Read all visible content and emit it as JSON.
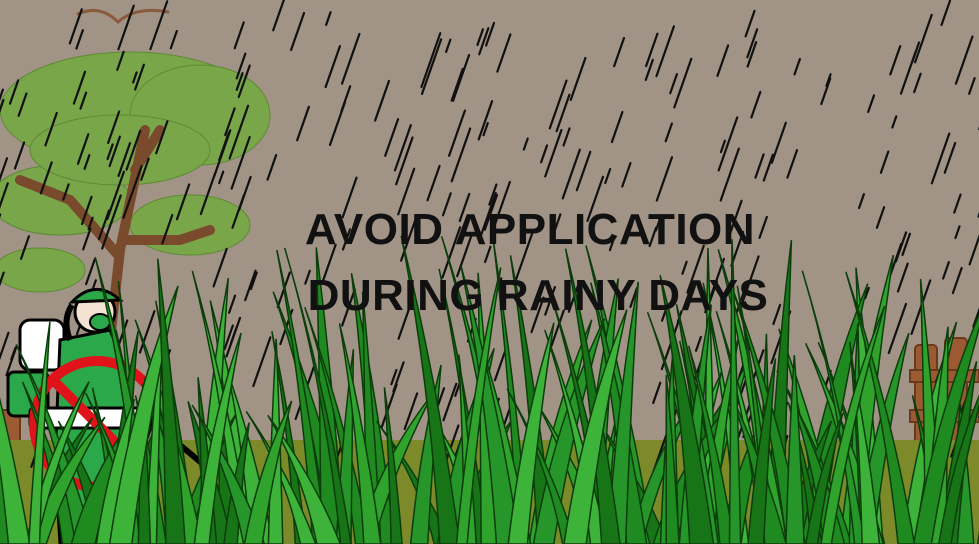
{
  "headline": {
    "line1": "AVOID APPLICATION",
    "line2": "DURING RAINY DAYS"
  },
  "colors": {
    "sky": "#a19386",
    "rain": "#111111",
    "tree_foliage": "#7aa64a",
    "tree_trunk": "#7a4a2c",
    "grass": "#1f8a1f",
    "grass_light": "#3db33a",
    "ground": "#7c8a2a",
    "worker_suit": "#2aa84a",
    "prohibition": "#e0121a",
    "fence": "#9b5a32"
  },
  "icons": [
    "rain-icon",
    "tree-icon",
    "bird-icon",
    "worker-icon",
    "prohibition-icon",
    "fence-icon",
    "grass-icon"
  ]
}
